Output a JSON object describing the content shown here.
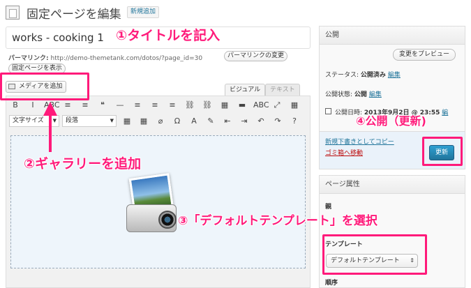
{
  "header": {
    "title": "固定ページを編集",
    "new_button": "新規追加"
  },
  "editor": {
    "title_value": "works - cooking 1",
    "permalink_label": "パーマリンク:",
    "permalink_url": "http://demo-themetank.com/dotos/?page_id=30",
    "change_permalink_button": "パーマリンクの変更",
    "view_page_button": "固定ページを表示",
    "media_button": "メディアを追加",
    "tab_visual": "ビジュアル",
    "tab_text": "テキスト",
    "toolbar_row1": [
      "B",
      "I",
      "ABC",
      "≡",
      "≡",
      "❝",
      "—",
      "≡",
      "≡",
      "≡",
      "⛓",
      "⛓",
      "▦",
      "▬",
      "ABC",
      "⤢",
      "▦"
    ],
    "toolbar_row2": [
      "▦",
      "▦",
      "⌀",
      "Ω",
      "A",
      "✎",
      "⇤",
      "⇥",
      "↶",
      "↷",
      "?"
    ],
    "format_select": "文字サイズ",
    "paragraph_select": "段落"
  },
  "publish": {
    "title": "公開",
    "preview_button": "変更をプレビュー",
    "status_label": "ステータス:",
    "status_value": "公開済み",
    "status_edit": "編集",
    "visibility_label": "公開状態:",
    "visibility_value": "公開",
    "visibility_edit": "編集",
    "date_label": "公開日時:",
    "date_value": "2013年9月2日 @ 23:55",
    "date_edit": "編",
    "copy_draft_link": "新規下書きとしてコピー",
    "trash_link": "ゴミ箱へ移動",
    "update_button": "更新"
  },
  "attributes": {
    "title": "ページ属性",
    "parent_label": "親",
    "template_label": "テンプレート",
    "template_value": "デフォルトテンプレート",
    "order_label": "順序"
  },
  "annotations": {
    "step1": "①タイトルを記入",
    "step2": "②ギャラリーを追加",
    "step3": "③「デフォルトテンプレート」を選択",
    "step4": "④公開（更新)"
  },
  "colors": {
    "annotation": "#ff1a7a",
    "link": "#21759b",
    "primary_button": "#21759b",
    "trash": "#bc0b0b"
  }
}
